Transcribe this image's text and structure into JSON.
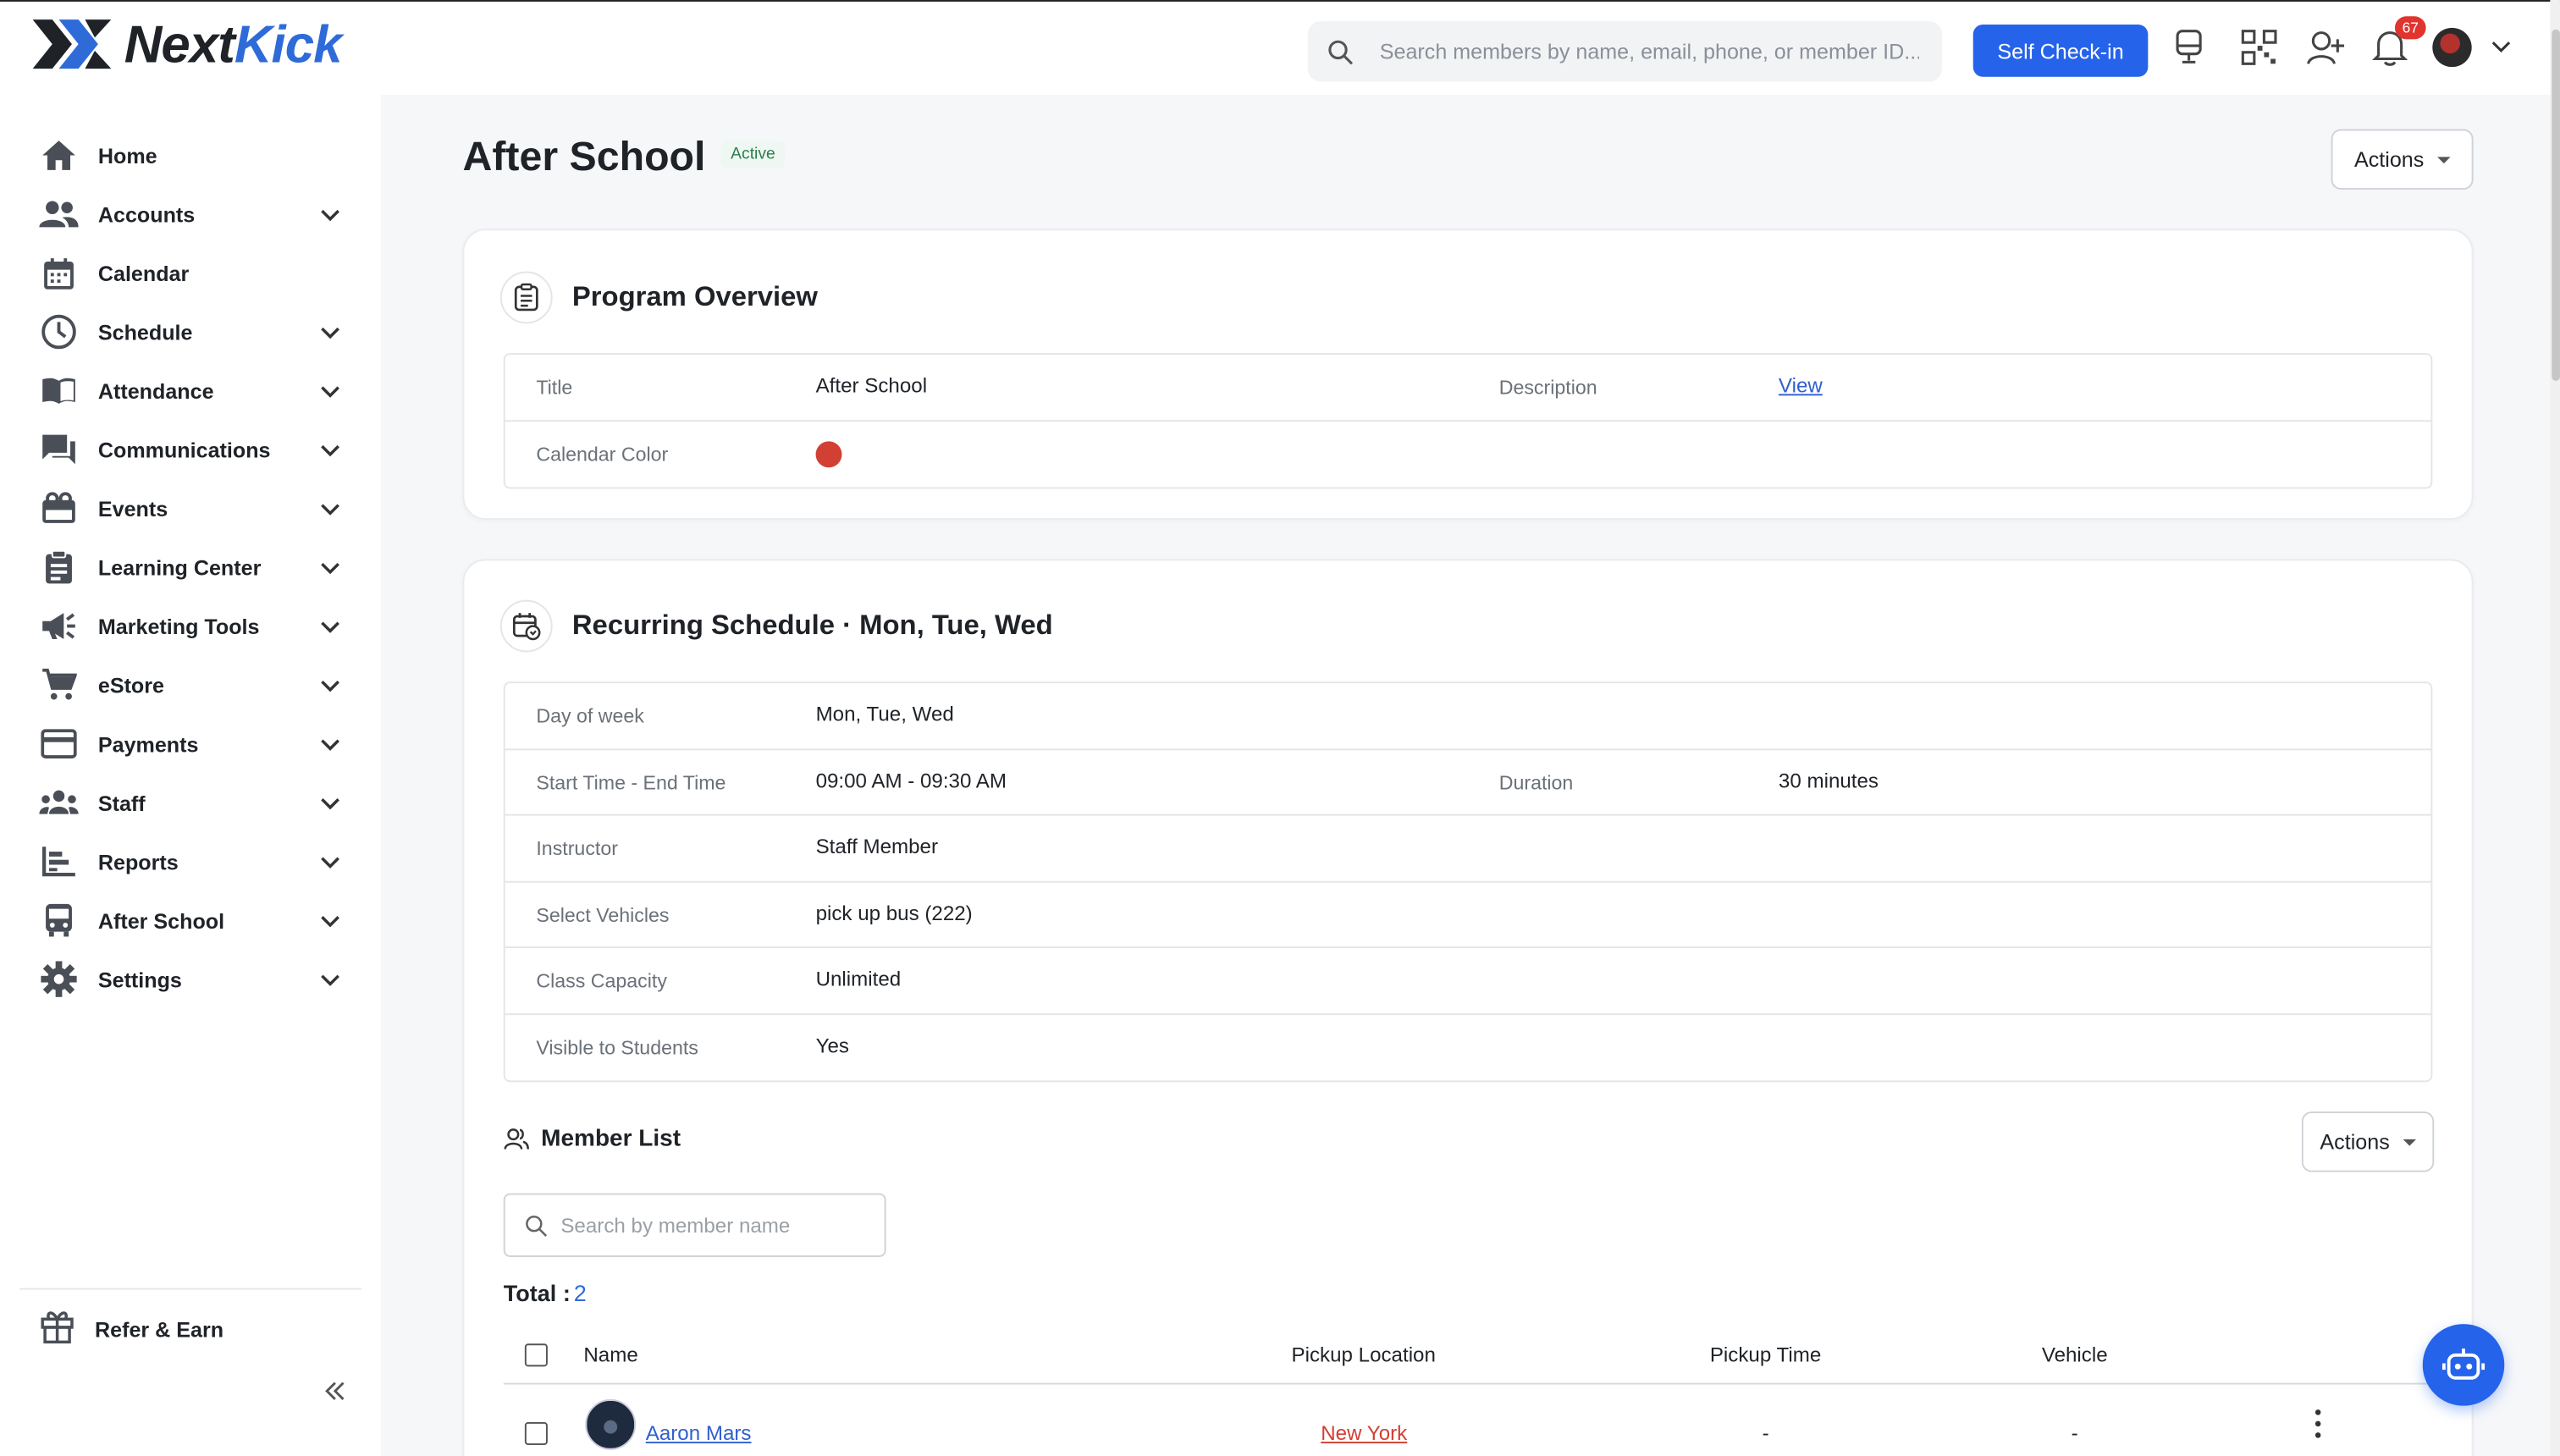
{
  "app": {
    "brand_part1": "Next",
    "brand_part2": "Kick"
  },
  "topbar": {
    "search_placeholder": "Search members by name, email, phone, or member ID...",
    "checkin_label": "Self Check-in",
    "notifications_count": "67",
    "accent_color": "#2563eb"
  },
  "sidebar": {
    "items": [
      {
        "label": "Home",
        "icon": "home-icon",
        "expandable": false
      },
      {
        "label": "Accounts",
        "icon": "people-icon",
        "expandable": true
      },
      {
        "label": "Calendar",
        "icon": "calendar-icon",
        "expandable": false
      },
      {
        "label": "Schedule",
        "icon": "clock-icon",
        "expandable": true
      },
      {
        "label": "Attendance",
        "icon": "book-icon",
        "expandable": true
      },
      {
        "label": "Communications",
        "icon": "chat-icon",
        "expandable": true
      },
      {
        "label": "Events",
        "icon": "ticket-icon",
        "expandable": true
      },
      {
        "label": "Learning Center",
        "icon": "clipboard-icon",
        "expandable": true
      },
      {
        "label": "Marketing Tools",
        "icon": "megaphone-icon",
        "expandable": true
      },
      {
        "label": "eStore",
        "icon": "cart-icon",
        "expandable": true
      },
      {
        "label": "Payments",
        "icon": "card-icon",
        "expandable": true
      },
      {
        "label": "Staff",
        "icon": "group-icon",
        "expandable": true
      },
      {
        "label": "Reports",
        "icon": "bar-chart-icon",
        "expandable": true
      },
      {
        "label": "After School",
        "icon": "bus-icon",
        "expandable": true
      },
      {
        "label": "Settings",
        "icon": "gear-icon",
        "expandable": true
      }
    ],
    "refer_label": "Refer & Earn"
  },
  "page": {
    "title": "After School",
    "status": "Active",
    "actions_label": "Actions"
  },
  "overview": {
    "heading": "Program Overview",
    "title_key": "Title",
    "title_value": "After School",
    "description_key": "Description",
    "description_link": "View",
    "color_key": "Calendar Color",
    "calendar_color": "#d23f33"
  },
  "schedule": {
    "heading": "Recurring Schedule · Mon, Tue, Wed",
    "rows": [
      {
        "key": "Day of week",
        "value": "Mon, Tue, Wed"
      },
      {
        "key": "Start Time - End Time",
        "value": "09:00 AM - 09:30 AM",
        "key2": "Duration",
        "value2": "30 minutes"
      },
      {
        "key": "Instructor",
        "value": "Staff Member"
      },
      {
        "key": "Select Vehicles",
        "value": "pick up bus (222)"
      },
      {
        "key": "Class Capacity",
        "value": "Unlimited"
      },
      {
        "key": "Visible to Students",
        "value": "Yes"
      }
    ]
  },
  "member_list": {
    "heading": "Member List",
    "actions_label": "Actions",
    "search_placeholder": "Search by member name",
    "total_label": "Total :",
    "total_value": "2",
    "columns": [
      "Name",
      "Pickup Location",
      "Pickup Time",
      "Vehicle"
    ],
    "rows": [
      {
        "name": "Aaron Mars",
        "pickup_location": "New York",
        "pickup_time": "-",
        "vehicle": "-"
      }
    ]
  }
}
